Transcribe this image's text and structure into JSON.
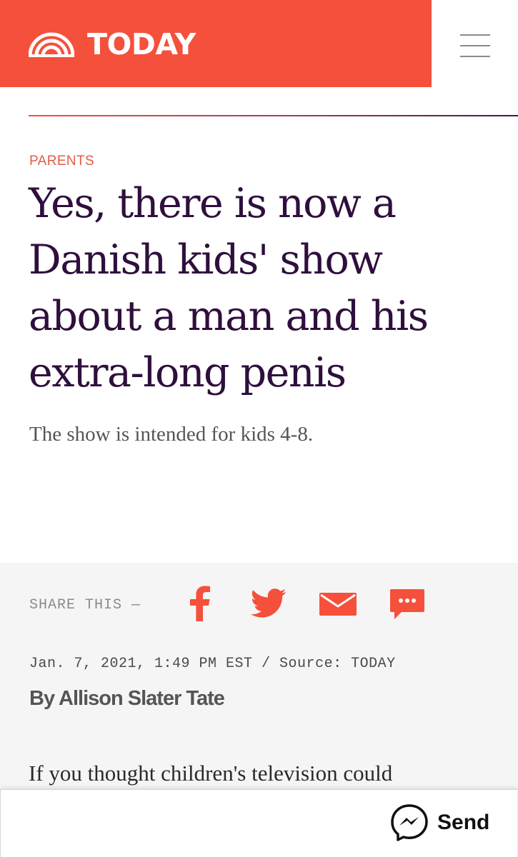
{
  "header": {
    "brand_name": "TODAY",
    "logo_icon": "today-sunrise-logo",
    "menu_icon": "hamburger-menu-icon",
    "brand_color": "#f5503b"
  },
  "article": {
    "category": "PARENTS",
    "headline": "Yes, there is now a Danish kids' show about a man and his extra-long penis",
    "dek": "The show is intended for kids 4-8.",
    "share_label": "SHARE THIS —",
    "share_icons": [
      "facebook-icon",
      "twitter-icon",
      "email-icon",
      "sms-icon"
    ],
    "timestamp": "Jan. 7, 2021, 1:49 PM EST / Source: TODAY",
    "byline": "By Allison Slater Tate",
    "body_start": "If you thought children's television could"
  },
  "send_bar": {
    "label": "Send",
    "icon": "messenger-icon"
  },
  "colors": {
    "accent": "#f5503b",
    "headline": "#2f0f3d",
    "meta_background": "#f5f5f5"
  }
}
